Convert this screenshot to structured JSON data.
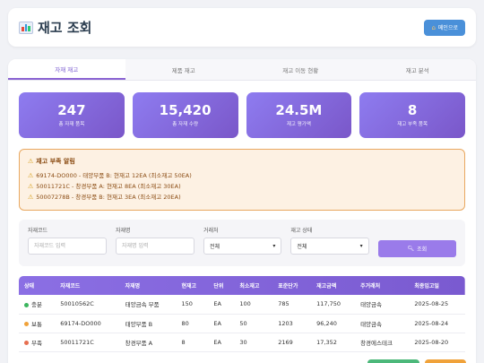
{
  "header": {
    "title": "재고 조회",
    "home_label": "메인으로"
  },
  "tabs": [
    {
      "label": "자재 재고",
      "active": true
    },
    {
      "label": "제품 재고",
      "active": false
    },
    {
      "label": "재고 이동 현황",
      "active": false
    },
    {
      "label": "재고 분석",
      "active": false
    }
  ],
  "stats": [
    {
      "value": "247",
      "label": "총 자재 품목"
    },
    {
      "value": "15,420",
      "label": "총 자재 수량"
    },
    {
      "value": "24.5M",
      "label": "재고 평가액"
    },
    {
      "value": "8",
      "label": "재고 부족 품목"
    }
  ],
  "alert": {
    "title": "재고 부족 알림",
    "items": [
      "69174-DO000 - 태양부품 B: 현재고 12EA (최소재고 50EA)",
      "50011721C - 창경부품 A: 현재고 8EA (최소재고 30EA)",
      "50007278B - 창경부품 B: 현재고 3EA (최소재고 20EA)"
    ]
  },
  "search": {
    "code_label": "자재코드",
    "code_placeholder": "자재코드 입력",
    "name_label": "자재명",
    "name_placeholder": "자재명 입력",
    "vendor_label": "거래처",
    "vendor_value": "전체",
    "status_label": "재고 상태",
    "status_value": "전체",
    "button_label": "조회"
  },
  "table": {
    "headers": [
      "상태",
      "자재코드",
      "자재명",
      "현재고",
      "단위",
      "최소재고",
      "표준단가",
      "재고금액",
      "주거래처",
      "최종입고일"
    ],
    "rows": [
      {
        "status": "충분",
        "status_color": "#3cb55e",
        "code": "50010562C",
        "name": "태양금속 부품",
        "qty": "150",
        "unit": "EA",
        "min": "100",
        "price": "785",
        "amount": "117,750",
        "vendor": "태양금속",
        "date": "2025-08-25"
      },
      {
        "status": "보통",
        "status_color": "#f0a23a",
        "code": "69174-DO000",
        "name": "태양부품 B",
        "qty": "80",
        "unit": "EA",
        "min": "50",
        "price": "1203",
        "amount": "96,240",
        "vendor": "태양금속",
        "date": "2025-08-24"
      },
      {
        "status": "부족",
        "status_color": "#e76f51",
        "code": "50011721C",
        "name": "창경부품 A",
        "qty": "8",
        "unit": "EA",
        "min": "30",
        "price": "2169",
        "amount": "17,352",
        "vendor": "창경에스테크",
        "date": "2025-08-20"
      }
    ]
  },
  "colors": {
    "accent": "#8a63d2",
    "warning_bg": "#fdf1e3",
    "warning_border": "#e9a860"
  }
}
